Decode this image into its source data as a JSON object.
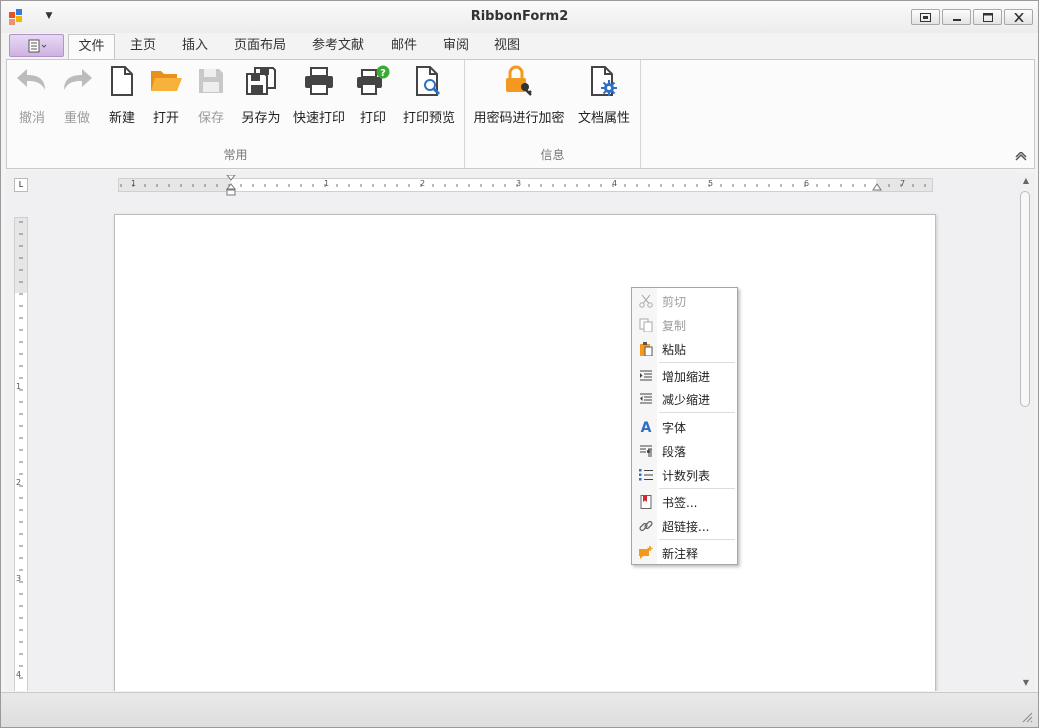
{
  "window": {
    "title": "RibbonForm2"
  },
  "tabs": [
    {
      "label": "文件",
      "active": true
    },
    {
      "label": "主页"
    },
    {
      "label": "插入"
    },
    {
      "label": "页面布局"
    },
    {
      "label": "参考文献"
    },
    {
      "label": "邮件"
    },
    {
      "label": "审阅"
    },
    {
      "label": "视图"
    }
  ],
  "ribbon": {
    "groups": {
      "common": {
        "label": "常用",
        "buttons": {
          "undo": {
            "label": "撤消",
            "icon": "undo-arrow-icon",
            "enabled": false
          },
          "redo": {
            "label": "重做",
            "icon": "redo-arrow-icon",
            "enabled": false
          },
          "new": {
            "label": "新建",
            "icon": "new-document-icon"
          },
          "open": {
            "label": "打开",
            "icon": "folder-open-icon"
          },
          "save": {
            "label": "保存",
            "icon": "floppy-save-icon",
            "enabled": false
          },
          "save_as": {
            "label": "另存为",
            "icon": "save-as-icon"
          },
          "quick_print": {
            "label": "快速打印",
            "icon": "printer-icon"
          },
          "print": {
            "label": "打印",
            "icon": "printer-question-icon"
          },
          "print_preview": {
            "label": "打印预览",
            "icon": "print-preview-icon"
          }
        }
      },
      "info": {
        "label": "信息",
        "buttons": {
          "encrypt": {
            "label": "用密码进行加密",
            "icon": "lock-key-icon"
          },
          "doc_props": {
            "label": "文档属性",
            "icon": "document-settings-icon"
          }
        }
      }
    }
  },
  "ruler": {
    "horizontal_numbers": [
      "1",
      "1",
      "2",
      "3",
      "4",
      "5",
      "6",
      "7"
    ],
    "vertical_numbers": [
      "1",
      "2",
      "3",
      "4"
    ]
  },
  "context_menu": {
    "items": {
      "cut": {
        "label": "剪切",
        "enabled": false,
        "icon": "scissors-icon"
      },
      "copy": {
        "label": "复制",
        "enabled": false,
        "icon": "copy-icon"
      },
      "paste": {
        "label": "粘贴",
        "icon": "paste-icon"
      },
      "increase_indent": {
        "label": "增加缩进",
        "icon": "increase-indent-icon"
      },
      "decrease_indent": {
        "label": "减少缩进",
        "icon": "decrease-indent-icon"
      },
      "font": {
        "label": "字体",
        "icon": "font-icon"
      },
      "paragraph": {
        "label": "段落",
        "icon": "paragraph-icon"
      },
      "numbered_list": {
        "label": "计数列表",
        "icon": "numbered-list-icon"
      },
      "bookmark": {
        "label": "书签...",
        "icon": "bookmark-icon"
      },
      "hyperlink": {
        "label": "超链接...",
        "icon": "hyperlink-icon"
      },
      "new_comment": {
        "label": "新注释",
        "icon": "comment-icon"
      }
    }
  },
  "colors": {
    "accent_purple": "#cdb2e2",
    "open_folder": "#f4a31c",
    "lock_orange": "#f39a1e",
    "print_badge_green": "#3aa935",
    "settings_blue": "#2f6fc6"
  }
}
